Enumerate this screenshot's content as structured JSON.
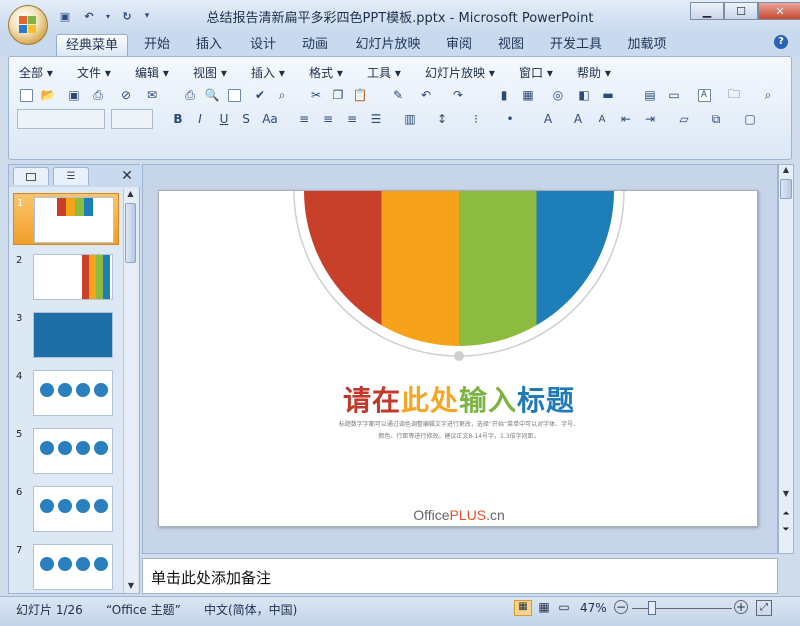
{
  "window": {
    "title": "总结报告清新扁平多彩四色PPT模板.pptx - Microsoft PowerPoint",
    "controls": {
      "minimize": "▁",
      "maximize": "☐",
      "close": "✕"
    }
  },
  "ribbon_tabs": [
    "经典菜单",
    "开始",
    "插入",
    "设计",
    "动画",
    "幻灯片放映",
    "审阅",
    "视图",
    "开发工具",
    "加载项"
  ],
  "menus": [
    "全部",
    "文件",
    "编辑",
    "视图",
    "插入",
    "格式",
    "工具",
    "幻灯片放映",
    "窗口",
    "帮助"
  ],
  "help_icon": "?",
  "slide": {
    "title_parts": [
      {
        "text": "请在",
        "color": "#c0392b"
      },
      {
        "text": "此处",
        "color": "#f5a623"
      },
      {
        "text": "输入",
        "color": "#7cb342"
      },
      {
        "text": "标题",
        "color": "#1f7ab8"
      }
    ],
    "description_line1": "标题数字字都可以通过调色调整编辑文字进行更改，选择“开始”菜单中可以对字体、字号、",
    "description_line2": "颜色、行距等进行修改。建议正文8-14号字，1.3倍字间距。",
    "logo_text_prefix": "Office",
    "logo_text_plus": "PLUS",
    "logo_text_suffix": ".cn",
    "color_bands": [
      "#c9402a",
      "#f7a21b",
      "#8cbb3f",
      "#1e7fb8"
    ]
  },
  "thumbnails": [
    {
      "num": "1",
      "selected": true
    },
    {
      "num": "2",
      "selected": false
    },
    {
      "num": "3",
      "selected": false
    },
    {
      "num": "4",
      "selected": false
    },
    {
      "num": "5",
      "selected": false
    },
    {
      "num": "6",
      "selected": false
    },
    {
      "num": "7",
      "selected": false
    }
  ],
  "notes": {
    "placeholder": "单击此处添加备注"
  },
  "status": {
    "slide_info": "幻灯片 1/26",
    "theme": "“Office 主题”",
    "language": "中文(简体，中国)",
    "zoom": "47%"
  }
}
